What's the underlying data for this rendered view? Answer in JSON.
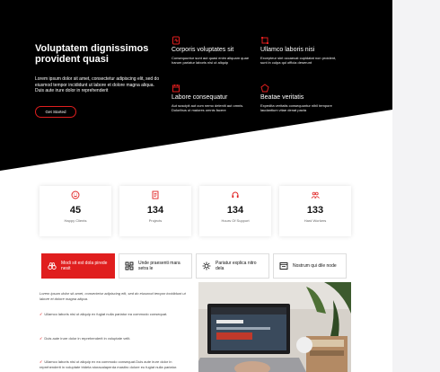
{
  "hero": {
    "title": "Voluptatem dignissimos provident quasi",
    "text": "Lorem ipsum dolor sit amet, consectetur adipiscing elit, sed do eiusmod tempor incididunt ut labore et dolore magna aliqua. Duis aute irure dolor in reprehenderit",
    "button": "Get Started"
  },
  "features": [
    {
      "icon": "activity-icon",
      "title": "Corporis voluptates sit",
      "desc": "Consequuntur sunt aut quasi enim aliquam quae harum pariatur laboris nisi ut aliquip"
    },
    {
      "icon": "bounding-box-icon",
      "title": "Ullamco laboris nisi",
      "desc": "Excepteur sint occaecat cupidatat non proident, sunt in culpa qui officia deserunt"
    },
    {
      "icon": "calendar-icon",
      "title": "Labore consequatur",
      "desc": "Aut suscipit aut cum nemo deleniti aut omnis. Doloribus ut maiores omnis facere"
    },
    {
      "icon": "pentagon-icon",
      "title": "Beatae veritatis",
      "desc": "Expedita veritatis consequuntur nihil tempore laudantium vitae denat pacta"
    }
  ],
  "stats": [
    {
      "icon": "emoji-smile-icon",
      "number": "45",
      "label": "Happy Clients"
    },
    {
      "icon": "journal-icon",
      "number": "134",
      "label": "Projects"
    },
    {
      "icon": "headset-icon",
      "number": "134",
      "label": "Hours Of Support"
    },
    {
      "icon": "people-icon",
      "number": "133",
      "label": "Hard Workers"
    }
  ],
  "tabs": [
    {
      "icon": "binoculars-icon",
      "label": "Modi sit est dola pirede nesit"
    },
    {
      "icon": "box-seam-icon",
      "label": "Unde praesenti mara setra le"
    },
    {
      "icon": "brightness-icon",
      "label": "Pariatur explica nitro dela"
    },
    {
      "icon": "command-icon",
      "label": "Nostrum qui dile node"
    }
  ],
  "content": {
    "lead": "Lorem ipsum dolor sit amet, consectetur adipiscing elit, sed do eiusmod tempor incididunt ut labore et dolore magna aliqua.",
    "checks": [
      "Ullamco laboris nisi ut aliquip ex fugiat nulla pariatur ea commodo consequat.",
      "Duis aute irure dolor in reprehenderit in voluptate velit.",
      "Ullamco laboris nisi ut aliquip ex ea commodo consequat.Duis aute irure dolor in reprehenderit in voluptate trideta storacalaperda mastiro dolore eu fugiat nulla pariatur."
    ]
  },
  "colors": {
    "accent": "#e01e1e",
    "hero_bg": "#000000"
  }
}
